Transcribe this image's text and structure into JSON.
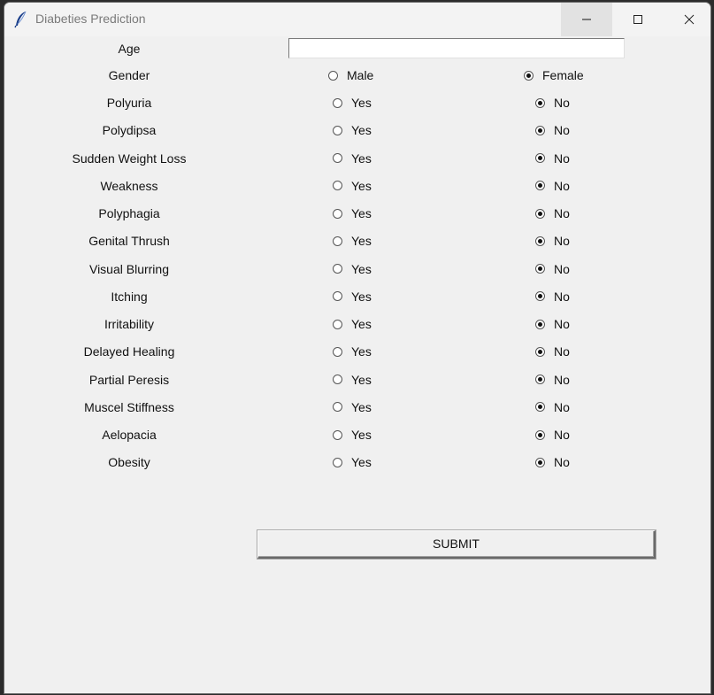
{
  "window": {
    "title": "Diabeties Prediction",
    "icon": "feather-icon"
  },
  "form": {
    "age_label": "Age",
    "age_value": "",
    "gender": {
      "label": "Gender",
      "options": [
        "Male",
        "Female"
      ],
      "selected": "Female"
    },
    "yes_label": "Yes",
    "no_label": "No",
    "questions": [
      {
        "label": "Polyuria",
        "selected": "No"
      },
      {
        "label": "Polydipsa",
        "selected": "No"
      },
      {
        "label": "Sudden Weight Loss",
        "selected": "No"
      },
      {
        "label": "Weakness",
        "selected": "No"
      },
      {
        "label": "Polyphagia",
        "selected": "No"
      },
      {
        "label": "Genital Thrush",
        "selected": "No"
      },
      {
        "label": "Visual Blurring",
        "selected": "No"
      },
      {
        "label": "Itching",
        "selected": "No"
      },
      {
        "label": "Irritability",
        "selected": "No"
      },
      {
        "label": "Delayed Healing",
        "selected": "No"
      },
      {
        "label": "Partial Peresis",
        "selected": "No"
      },
      {
        "label": "Muscel Stiffness",
        "selected": "No"
      },
      {
        "label": "Aelopacia",
        "selected": "No"
      },
      {
        "label": "Obesity",
        "selected": "No"
      }
    ],
    "submit_label": "SUBMIT"
  }
}
